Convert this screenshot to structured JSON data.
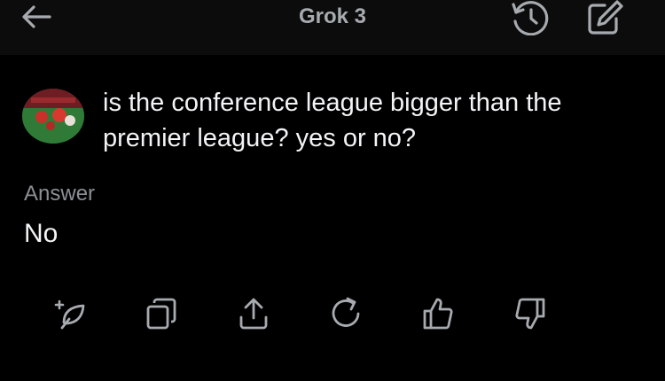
{
  "header": {
    "title": "Grok 3",
    "icons": [
      "back-arrow-icon",
      "history-icon",
      "edit-icon"
    ]
  },
  "conversation": {
    "question": "is the conference league bigger than the premier league? yes or no?",
    "answer_label": "Answer",
    "answer": "No"
  },
  "actions": [
    "sparkle-leaf-icon",
    "copy-icon",
    "share-icon",
    "regenerate-icon",
    "thumbs-up-icon",
    "thumbs-down-icon"
  ],
  "colors": {
    "background": "#000000",
    "header_bg": "#0c0c0c",
    "icon": "#a7abb0",
    "muted_text": "#8b8f93"
  }
}
